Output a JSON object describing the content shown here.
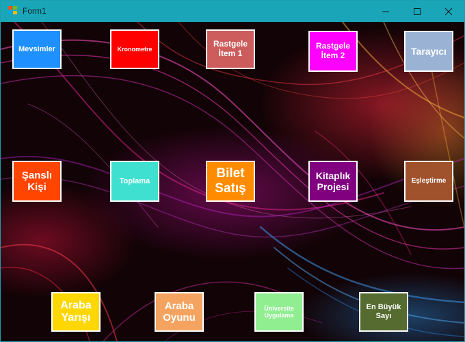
{
  "window": {
    "title": "Form1"
  },
  "controls": {
    "minimize": "minimize",
    "maximize": "maximize",
    "close": "close"
  },
  "buttons": [
    {
      "id": "mevsimler",
      "label": "Mevsimler",
      "color": "#1e90ff"
    },
    {
      "id": "kronometre",
      "label": "Kronometre",
      "color": "#ff0000"
    },
    {
      "id": "rastgele-item-1",
      "label": "Rastgele\nİtem 1",
      "color": "#cd5c5c"
    },
    {
      "id": "rastgele-item-2",
      "label": "Rastgele\nİtem 2",
      "color": "#ff00ff"
    },
    {
      "id": "tarayici",
      "label": "Tarayıcı",
      "color": "#9ab3d5"
    },
    {
      "id": "sansli-kisi",
      "label": "Şanslı\nKişi",
      "color": "#ff4500"
    },
    {
      "id": "toplama",
      "label": "Toplama",
      "color": "#40e0d0"
    },
    {
      "id": "bilet-satis",
      "label": "Bilet\nSatış",
      "color": "#ff8c00"
    },
    {
      "id": "kitaplik-projesi",
      "label": "Kitaplık\nProjesi",
      "color": "#800080"
    },
    {
      "id": "eslestirme",
      "label": "Eşleştirme",
      "color": "#a0522d"
    },
    {
      "id": "araba-yarisi",
      "label": "Araba\nYarışı",
      "color": "#ffd700"
    },
    {
      "id": "araba-oyunu",
      "label": "Araba\nOyunu",
      "color": "#f4a460"
    },
    {
      "id": "universite-uygulama",
      "label": "Üniversite\nUygulama",
      "color": "#90ee90"
    },
    {
      "id": "en-buyuk-sayi",
      "label": "En Büyük\nSayı",
      "color": "#556b2f"
    }
  ]
}
